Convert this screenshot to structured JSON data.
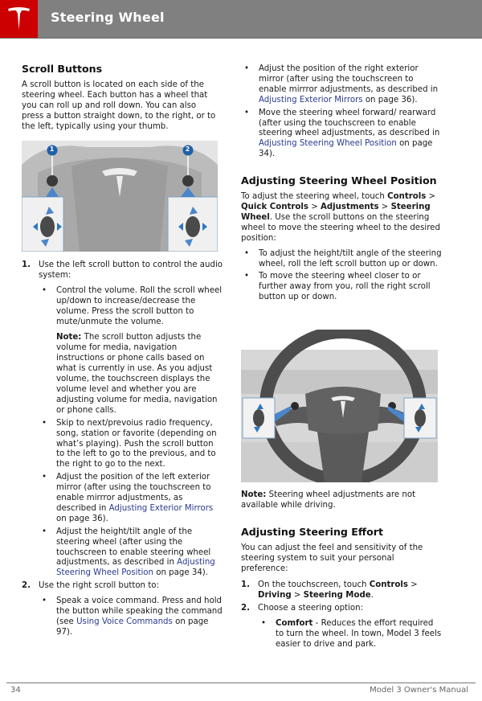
{
  "header": {
    "title": "Steering Wheel",
    "logo": "tesla-logo-icon",
    "brand_color": "#cc0000",
    "bar_color": "#808080"
  },
  "left": {
    "heading": "Scroll Buttons",
    "intro": "A scroll button is located on each side of the steering wheel. Each button has a wheel that you can roll up and roll down. You can also press a button straight down, to the right, or to the left, typically using your thumb.",
    "figure": {
      "callouts": [
        "1",
        "2"
      ]
    },
    "item1": {
      "num": "1.",
      "text": "Use the left scroll button to control the audio system:",
      "bullets": [
        {
          "text": "Control the volume. Roll the scroll wheel up/down to increase/decrease the volume. Press the scroll button to mute/unmute the volume."
        },
        {
          "text": "Skip to next/prevoius radio frequency, song, station or favorite (depending on what’s playing). Push the scroll button to the left to go to the previous, and to the right to go to the next."
        },
        {
          "pre": "Adjust the position of the left exterior mirror (after using the touchscreen to enable mirrror adjustments, as described in ",
          "link": "Adjusting Exterior Mirrors",
          "post": " on page 36)."
        },
        {
          "pre": "Adjust the height/tilt angle of the steering wheel (after using the touchscreen to enable steering wheel adjustments, as described in ",
          "link": "Adjusting Steering Wheel Position",
          "post": " on page 34)."
        }
      ],
      "note_label": "Note:",
      "note_text": " The scroll button adjusts the volume for media, navigation instructions or phone calls based on what is currently in use. As you adjust volume, the touchscreen displays the volume level and whether you are adjusting volume for media, navigation or phone calls."
    },
    "item2": {
      "num": "2.",
      "text": "Use the right scroll button to:",
      "bullet": {
        "pre": "Speak a voice command. Press and hold the button while speaking the command (see ",
        "link": "Using Voice Commands",
        "post": " on page 97)."
      }
    }
  },
  "right": {
    "bullets_top": [
      {
        "pre": "Adjust the position of the right exterior mirror (after using the touchscreen to enable mirrror adjustments, as described in ",
        "link": "Adjusting Exterior Mirrors",
        "post": " on page 36)."
      },
      {
        "pre": "Move the steering wheel forward/ rearward (after using the touchscreen to enable steering wheel adjustments, as described in ",
        "link": "Adjusting Steering Wheel Position",
        "post": " on page 34)."
      }
    ],
    "position": {
      "heading": "Adjusting Steering Wheel Position",
      "p_pre": "To adjust the steering wheel, touch ",
      "b1": "Controls",
      "sep1": " > ",
      "b2": "Quick Controls",
      "sep2": " > ",
      "b3": "Adjustments",
      "sep3": " > ",
      "b4": "Steering Wheel",
      "p_post": ". Use the scroll buttons on the steering wheel to move the steering wheel to the desired position:",
      "bullets": [
        "To adjust the height/tilt angle of the steering wheel, roll the left scroll button up or down.",
        "To move the steering wheel closer to or further away from you, roll the right scroll button up or down."
      ],
      "note_label": "Note:",
      "note_text": " Steering wheel adjustments are not available while driving."
    },
    "effort": {
      "heading": "Adjusting Steering Effort",
      "intro": "You can adjust the feel and sensitivity of the steering system to suit your personal preference:",
      "step1_num": "1.",
      "step1_pre": "On the touchscreen, touch ",
      "step1_b1": "Controls",
      "step1_sep1": " > ",
      "step1_b2": "Driving",
      "step1_sep2": " > ",
      "step1_b3": "Steering Mode",
      "step1_post": ".",
      "step2_num": "2.",
      "step2_text": "Choose a steering option:",
      "option_label": "Comfort",
      "option_text": " - Reduces the effort required to turn the wheel. In town, Model 3 feels easier to drive and park."
    }
  },
  "footer": {
    "page_number": "34",
    "manual_title": "Model 3 Owner's Manual"
  }
}
